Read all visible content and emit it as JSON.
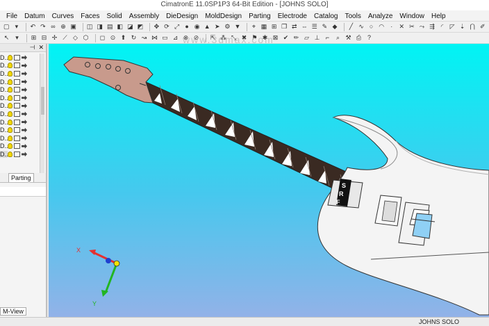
{
  "window": {
    "title": "CimatronE 11.0SP1P3 64-Bit Edition - [JOHNS SOLO]"
  },
  "menubar": {
    "items": [
      "File",
      "Datum",
      "Curves",
      "Faces",
      "Solid",
      "Assembly",
      "DieDesign",
      "MoldDesign",
      "Parting",
      "Electrode",
      "Catalog",
      "Tools",
      "Analyze",
      "Window",
      "Help"
    ]
  },
  "watermark": "www.3dmax.com",
  "left_panel": {
    "tree_rows": [
      "D...",
      "D...",
      "D...",
      "D...",
      "D...",
      "D...",
      "D...",
      "D...",
      "D...",
      "D...",
      "D...",
      "D...",
      "D..."
    ],
    "tab_label": "Parting",
    "bottom_tab": "M-View"
  },
  "viewport": {
    "axis_x_label": "X",
    "axis_y_label": "Y",
    "pickup_letters": [
      "S",
      "R",
      "F"
    ],
    "colors": {
      "bg_top": "#00f4f4",
      "bg_bottom": "#92b2e8",
      "neck": "#3a2a22",
      "headstock": "#c89a8c"
    }
  },
  "statusbar": {
    "project": "JOHNS SOLO"
  }
}
